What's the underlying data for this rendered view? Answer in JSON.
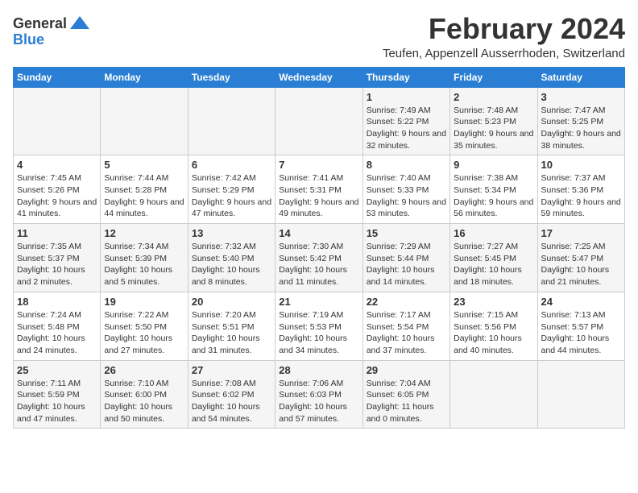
{
  "logo": {
    "text_general": "General",
    "text_blue": "Blue"
  },
  "header": {
    "month_year": "February 2024",
    "location": "Teufen, Appenzell Ausserrhoden, Switzerland"
  },
  "weekdays": [
    "Sunday",
    "Monday",
    "Tuesday",
    "Wednesday",
    "Thursday",
    "Friday",
    "Saturday"
  ],
  "weeks": [
    [
      {
        "day": "",
        "text": ""
      },
      {
        "day": "",
        "text": ""
      },
      {
        "day": "",
        "text": ""
      },
      {
        "day": "",
        "text": ""
      },
      {
        "day": "1",
        "text": "Sunrise: 7:49 AM\nSunset: 5:22 PM\nDaylight: 9 hours and 32 minutes."
      },
      {
        "day": "2",
        "text": "Sunrise: 7:48 AM\nSunset: 5:23 PM\nDaylight: 9 hours and 35 minutes."
      },
      {
        "day": "3",
        "text": "Sunrise: 7:47 AM\nSunset: 5:25 PM\nDaylight: 9 hours and 38 minutes."
      }
    ],
    [
      {
        "day": "4",
        "text": "Sunrise: 7:45 AM\nSunset: 5:26 PM\nDaylight: 9 hours and 41 minutes."
      },
      {
        "day": "5",
        "text": "Sunrise: 7:44 AM\nSunset: 5:28 PM\nDaylight: 9 hours and 44 minutes."
      },
      {
        "day": "6",
        "text": "Sunrise: 7:42 AM\nSunset: 5:29 PM\nDaylight: 9 hours and 47 minutes."
      },
      {
        "day": "7",
        "text": "Sunrise: 7:41 AM\nSunset: 5:31 PM\nDaylight: 9 hours and 49 minutes."
      },
      {
        "day": "8",
        "text": "Sunrise: 7:40 AM\nSunset: 5:33 PM\nDaylight: 9 hours and 53 minutes."
      },
      {
        "day": "9",
        "text": "Sunrise: 7:38 AM\nSunset: 5:34 PM\nDaylight: 9 hours and 56 minutes."
      },
      {
        "day": "10",
        "text": "Sunrise: 7:37 AM\nSunset: 5:36 PM\nDaylight: 9 hours and 59 minutes."
      }
    ],
    [
      {
        "day": "11",
        "text": "Sunrise: 7:35 AM\nSunset: 5:37 PM\nDaylight: 10 hours and 2 minutes."
      },
      {
        "day": "12",
        "text": "Sunrise: 7:34 AM\nSunset: 5:39 PM\nDaylight: 10 hours and 5 minutes."
      },
      {
        "day": "13",
        "text": "Sunrise: 7:32 AM\nSunset: 5:40 PM\nDaylight: 10 hours and 8 minutes."
      },
      {
        "day": "14",
        "text": "Sunrise: 7:30 AM\nSunset: 5:42 PM\nDaylight: 10 hours and 11 minutes."
      },
      {
        "day": "15",
        "text": "Sunrise: 7:29 AM\nSunset: 5:44 PM\nDaylight: 10 hours and 14 minutes."
      },
      {
        "day": "16",
        "text": "Sunrise: 7:27 AM\nSunset: 5:45 PM\nDaylight: 10 hours and 18 minutes."
      },
      {
        "day": "17",
        "text": "Sunrise: 7:25 AM\nSunset: 5:47 PM\nDaylight: 10 hours and 21 minutes."
      }
    ],
    [
      {
        "day": "18",
        "text": "Sunrise: 7:24 AM\nSunset: 5:48 PM\nDaylight: 10 hours and 24 minutes."
      },
      {
        "day": "19",
        "text": "Sunrise: 7:22 AM\nSunset: 5:50 PM\nDaylight: 10 hours and 27 minutes."
      },
      {
        "day": "20",
        "text": "Sunrise: 7:20 AM\nSunset: 5:51 PM\nDaylight: 10 hours and 31 minutes."
      },
      {
        "day": "21",
        "text": "Sunrise: 7:19 AM\nSunset: 5:53 PM\nDaylight: 10 hours and 34 minutes."
      },
      {
        "day": "22",
        "text": "Sunrise: 7:17 AM\nSunset: 5:54 PM\nDaylight: 10 hours and 37 minutes."
      },
      {
        "day": "23",
        "text": "Sunrise: 7:15 AM\nSunset: 5:56 PM\nDaylight: 10 hours and 40 minutes."
      },
      {
        "day": "24",
        "text": "Sunrise: 7:13 AM\nSunset: 5:57 PM\nDaylight: 10 hours and 44 minutes."
      }
    ],
    [
      {
        "day": "25",
        "text": "Sunrise: 7:11 AM\nSunset: 5:59 PM\nDaylight: 10 hours and 47 minutes."
      },
      {
        "day": "26",
        "text": "Sunrise: 7:10 AM\nSunset: 6:00 PM\nDaylight: 10 hours and 50 minutes."
      },
      {
        "day": "27",
        "text": "Sunrise: 7:08 AM\nSunset: 6:02 PM\nDaylight: 10 hours and 54 minutes."
      },
      {
        "day": "28",
        "text": "Sunrise: 7:06 AM\nSunset: 6:03 PM\nDaylight: 10 hours and 57 minutes."
      },
      {
        "day": "29",
        "text": "Sunrise: 7:04 AM\nSunset: 6:05 PM\nDaylight: 11 hours and 0 minutes."
      },
      {
        "day": "",
        "text": ""
      },
      {
        "day": "",
        "text": ""
      }
    ]
  ]
}
